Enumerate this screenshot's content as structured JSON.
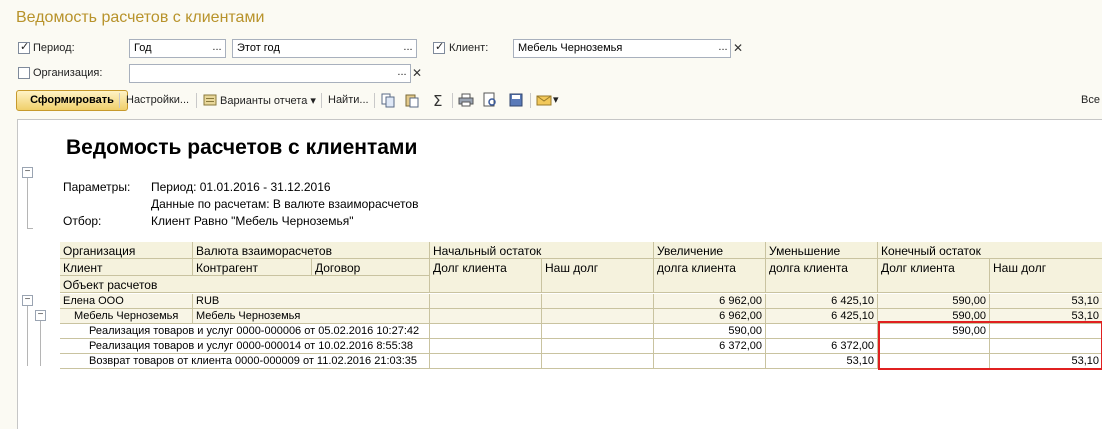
{
  "window": {
    "title": "Ведомость расчетов с клиентами"
  },
  "filters": {
    "period": {
      "label": "Период:",
      "checked": true,
      "type_value": "Год",
      "value": "Этот год"
    },
    "client": {
      "label": "Клиент:",
      "checked": true,
      "value": "Мебель Черноземья"
    },
    "organization": {
      "label": "Организация:",
      "checked": false,
      "value": ""
    },
    "dots": "...",
    "clear": "✕"
  },
  "toolbar": {
    "generate": "Сформировать",
    "settings": "Настройки...",
    "variants": "Варианты отчета",
    "find": "Найти...",
    "all": "Все"
  },
  "report": {
    "title": "Ведомость расчетов с клиентами",
    "params_label": "Параметры:",
    "param_period": "Период: 01.01.2016 - 31.12.2016",
    "param_data": "Данные по расчетам: В валюте взаиморасчетов",
    "filter_label": "Отбор:",
    "filter_value": "Клиент Равно \"Мебель Черноземья\"",
    "headers": {
      "organization": "Организация",
      "currency": "Валюта взаиморасчетов",
      "start_balance": "Начальный остаток",
      "increase": "Увеличение",
      "decrease": "Уменьшение",
      "end_balance": "Конечный остаток",
      "client": "Клиент",
      "counterparty": "Контрагент",
      "contract": "Договор",
      "client_debt": "Долг клиента",
      "our_debt": "Наш долг",
      "client_debt_inc": "долга клиента",
      "client_debt_dec": "долга клиента",
      "end_client_debt": "Долг клиента",
      "end_our_debt": "Наш долг",
      "settlement_object": "Объект расчетов"
    },
    "rows": [
      {
        "name": "Елена ООО",
        "col2": "RUB",
        "increase": "6 962,00",
        "decrease": "6 425,10",
        "end_client": "590,00",
        "end_our": "53,10"
      },
      {
        "name": "Мебель Черноземья",
        "col2": "Мебель Черноземья",
        "increase": "6 962,00",
        "decrease": "6 425,10",
        "end_client": "590,00",
        "end_our": "53,10"
      },
      {
        "name": "Реализация товаров и услуг 0000-000006 от 05.02.2016 10:27:42",
        "increase": "590,00",
        "decrease": "",
        "end_client": "590,00",
        "end_our": ""
      },
      {
        "name": "Реализация товаров и услуг 0000-000014 от 10.02.2016 8:55:38",
        "increase": "6 372,00",
        "decrease": "6 372,00",
        "end_client": "",
        "end_our": ""
      },
      {
        "name": "Возврат товаров от клиента 0000-000009 от 11.02.2016 21:03:35",
        "increase": "",
        "decrease": "53,10",
        "end_client": "",
        "end_our": "53,10"
      }
    ]
  },
  "colors": {
    "title": "#b8932b",
    "highlight": "#e02020",
    "header_bg": "#f5f2dd"
  }
}
